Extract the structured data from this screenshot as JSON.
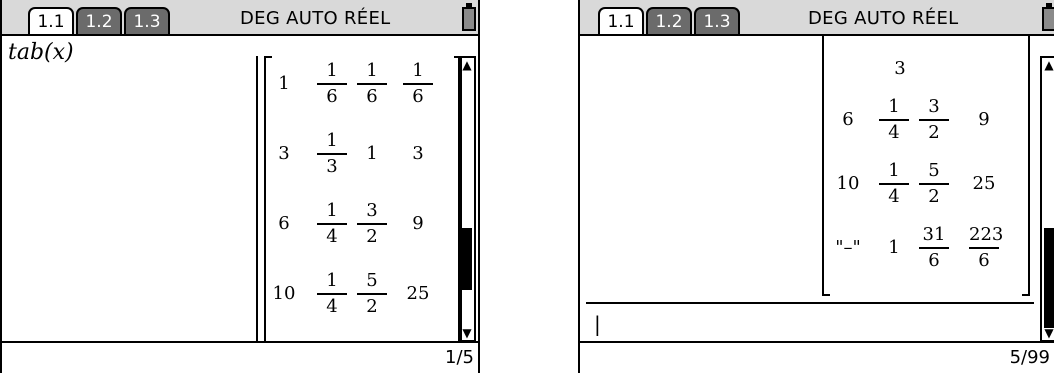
{
  "left": {
    "tabs": [
      "1.1",
      "1.2",
      "1.3"
    ],
    "status": "DEG AUTO RÉEL",
    "expression": "tab(x)",
    "pager": "1/5",
    "rows": [
      [
        "1",
        {
          "n": "1",
          "d": "6"
        },
        {
          "n": "1",
          "d": "6"
        },
        {
          "n": "1",
          "d": "6"
        }
      ],
      [
        "3",
        {
          "n": "1",
          "d": "3"
        },
        "1",
        "3"
      ],
      [
        "6",
        {
          "n": "1",
          "d": "4"
        },
        {
          "n": "3",
          "d": "2"
        },
        "9"
      ],
      [
        "10",
        {
          "n": "1",
          "d": "4"
        },
        {
          "n": "5",
          "d": "2"
        },
        "25"
      ]
    ]
  },
  "right": {
    "tabs": [
      "1.1",
      "1.2",
      "1.3"
    ],
    "status": "DEG AUTO RÉEL",
    "pager": "5/99",
    "cursor": "|",
    "partial_top": "3",
    "rows": [
      [
        "6",
        {
          "n": "1",
          "d": "4"
        },
        {
          "n": "3",
          "d": "2"
        },
        "9"
      ],
      [
        "10",
        {
          "n": "1",
          "d": "4"
        },
        {
          "n": "5",
          "d": "2"
        },
        "25"
      ],
      [
        "\"–\"",
        "1",
        {
          "n": "31",
          "d": "6"
        },
        {
          "n": "223",
          "d": "6"
        }
      ]
    ]
  }
}
